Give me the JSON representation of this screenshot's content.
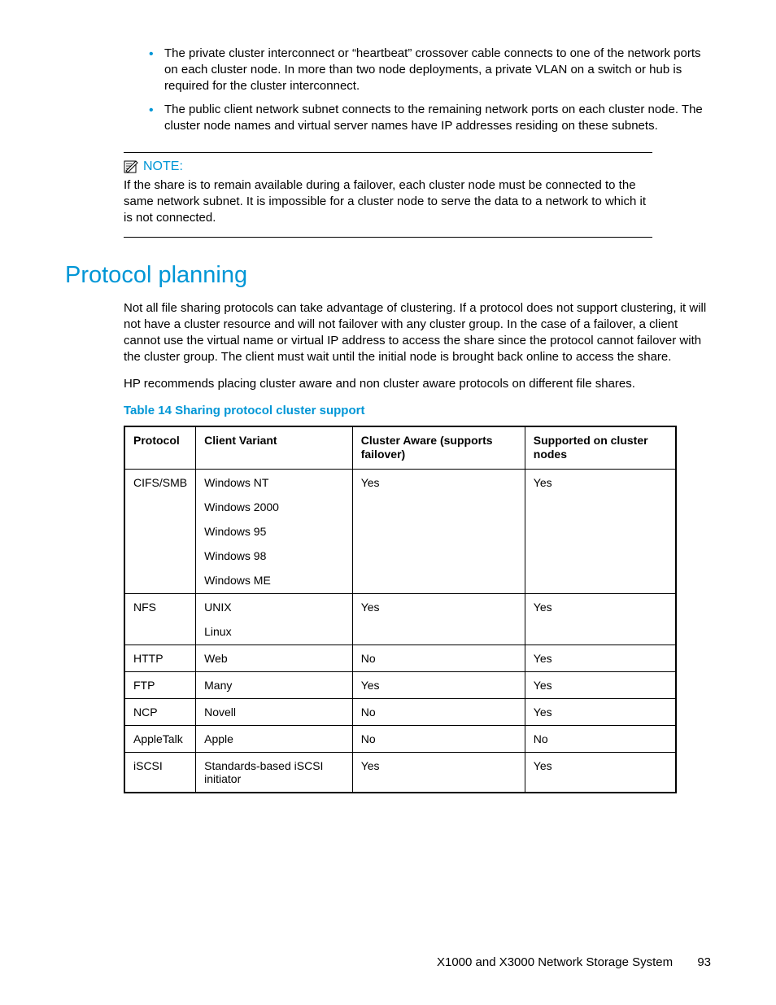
{
  "bullets": [
    "The private cluster interconnect or “heartbeat” crossover cable connects to one of the network ports on each cluster node. In more than two node deployments, a private VLAN on a switch or hub is required for the cluster interconnect.",
    "The public client network subnet connects to the remaining network ports on each cluster node. The cluster node names and virtual server names have IP addresses residing on these subnets."
  ],
  "note": {
    "label": "NOTE:",
    "body": "If the share is to remain available during a failover, each cluster node must be connected to the same network subnet. It is impossible for a cluster node to serve the data to a network to which it is not connected."
  },
  "section_heading": "Protocol planning",
  "paragraphs": [
    "Not all file sharing protocols can take advantage of clustering. If a protocol does not support clustering, it will not have a cluster resource and will not failover with any cluster group. In the case of a failover, a client cannot use the virtual name or virtual IP address to access the share since the protocol cannot failover with the cluster group. The client must wait until the initial node is brought back online to access the share.",
    "HP recommends placing cluster aware and non cluster aware protocols on different file shares."
  ],
  "table_caption": "Table 14 Sharing protocol cluster support",
  "table": {
    "headers": [
      "Protocol",
      "Client Variant",
      "Cluster Aware (supports failover)",
      "Supported on cluster nodes"
    ],
    "rows": [
      {
        "protocol": "CIFS/SMB",
        "variants": [
          "Windows NT",
          "Windows 2000",
          "Windows 95",
          "Windows 98",
          "Windows ME"
        ],
        "aware": "Yes",
        "supported": "Yes"
      },
      {
        "protocol": "NFS",
        "variants": [
          "UNIX",
          "Linux"
        ],
        "aware": "Yes",
        "supported": "Yes"
      },
      {
        "protocol": "HTTP",
        "variants": [
          "Web"
        ],
        "aware": "No",
        "supported": "Yes"
      },
      {
        "protocol": "FTP",
        "variants": [
          "Many"
        ],
        "aware": "Yes",
        "supported": "Yes"
      },
      {
        "protocol": "NCP",
        "variants": [
          "Novell"
        ],
        "aware": "No",
        "supported": "Yes"
      },
      {
        "protocol": "AppleTalk",
        "variants": [
          "Apple"
        ],
        "aware": "No",
        "supported": "No"
      },
      {
        "protocol": "iSCSI",
        "variants": [
          "Standards-based iSCSI initiator"
        ],
        "aware": "Yes",
        "supported": "Yes"
      }
    ]
  },
  "footer": {
    "title": "X1000 and X3000 Network Storage System",
    "page": "93"
  }
}
